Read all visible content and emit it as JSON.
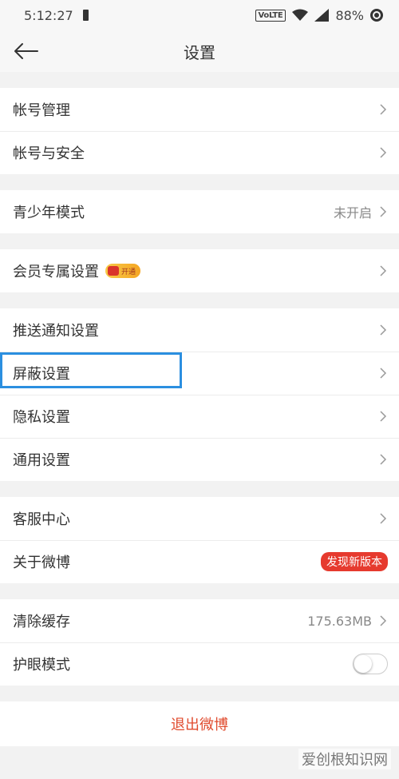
{
  "status_bar": {
    "time": "5:12:27",
    "network": "VoLTE",
    "battery": "88%"
  },
  "header": {
    "title": "设置"
  },
  "groups": [
    {
      "items": [
        {
          "label": "帐号管理"
        },
        {
          "label": "帐号与安全"
        }
      ]
    },
    {
      "items": [
        {
          "label": "青少年模式",
          "value": "未开启"
        }
      ]
    },
    {
      "items": [
        {
          "label": "会员专属设置",
          "badge": "开通"
        }
      ]
    },
    {
      "items": [
        {
          "label": "推送通知设置"
        },
        {
          "label": "屏蔽设置"
        },
        {
          "label": "隐私设置"
        },
        {
          "label": "通用设置"
        }
      ]
    },
    {
      "items": [
        {
          "label": "客服中心"
        },
        {
          "label": "关于微博",
          "badge": "发现新版本"
        }
      ]
    },
    {
      "items": [
        {
          "label": "清除缓存",
          "value": "175.63MB"
        },
        {
          "label": "护眼模式",
          "toggle_on": false
        }
      ]
    }
  ],
  "logout_label": "退出微博",
  "watermark": "爱创根知识网",
  "colors": {
    "highlight": "#2b8fe0",
    "logout": "#e04b2e",
    "new_badge": "#e63a2e"
  }
}
